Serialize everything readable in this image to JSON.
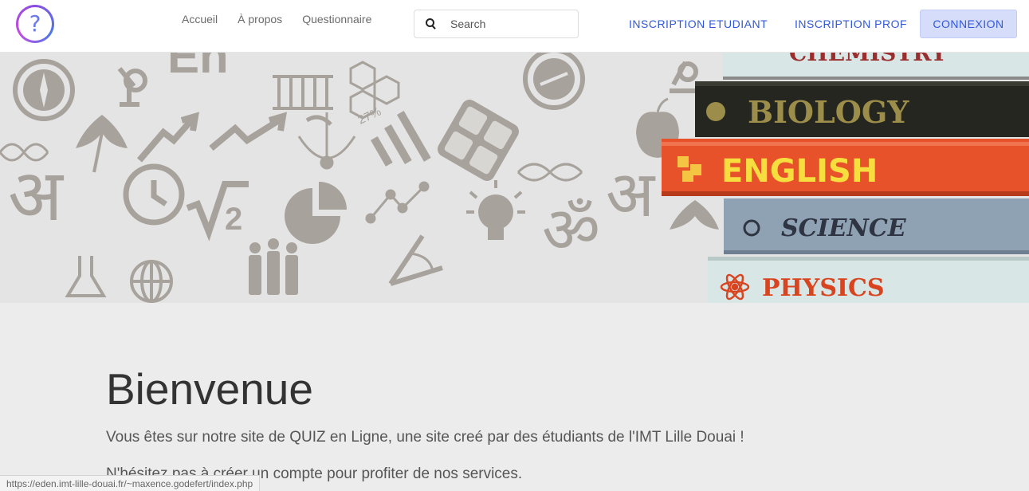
{
  "nav": {
    "links": [
      "Accueil",
      "À propos",
      "Questionnaire"
    ],
    "search_placeholder": "Search",
    "inscription_etudiant": "INSCRIPTION ETUDIANT",
    "inscription_prof": "INSCRIPTION PROF",
    "connexion": "CONNEXION"
  },
  "hero": {
    "books": [
      "CHEMISTRY",
      "BIOLOGY",
      "ENGLISH",
      "SCIENCE",
      "PHYSICS"
    ],
    "percent_label": "27%"
  },
  "main": {
    "title": "Bienvenue",
    "para1": "Vous êtes sur notre site de QUIZ en Ligne, une site creé par des étudiants de l'IMT Lille Douai !",
    "para2": "N'hésitez pas à créer un compte pour profiter de nos services."
  },
  "status_url": "https://eden.imt-lille-douai.fr/~maxence.godefert/index.php",
  "colors": {
    "accent": "#3158d8",
    "button_bg": "#d6ddfb",
    "icons": "#a8a29c"
  }
}
